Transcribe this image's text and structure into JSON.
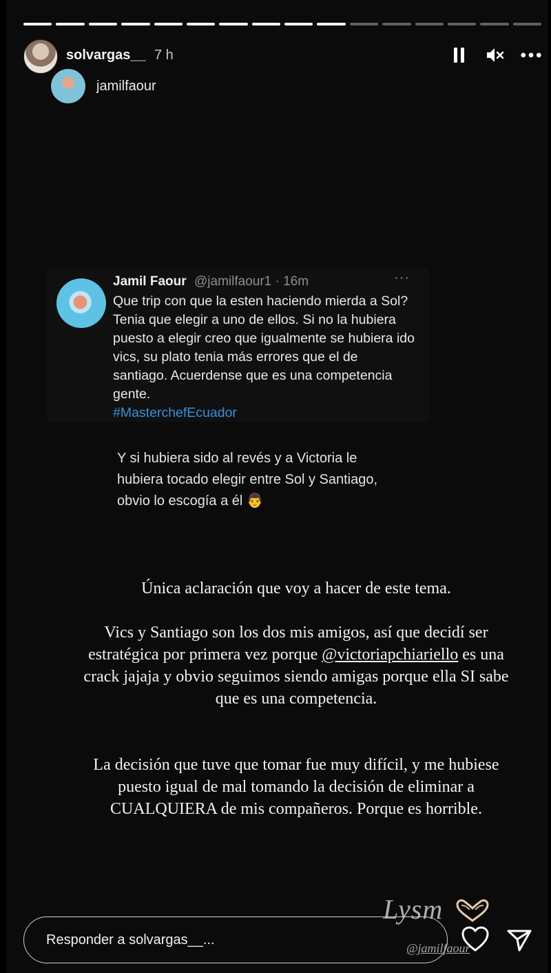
{
  "story": {
    "progress": {
      "segments": 16,
      "completed": 10
    },
    "header": {
      "username": "solvargas__",
      "time": "7 h",
      "mention": "jamilfaour"
    },
    "tweet": {
      "name": "Jamil Faour",
      "handle": "@jamilfaour1 · 16m",
      "more": "···",
      "text": "Que trip con que la esten haciendo mierda a Sol? Tenia que elegir a uno de ellos. Si no la hubiera puesto a elegir creo que igualmente se hubiera ido vics, su plato tenia más errores que el de santiago. Acuerdense que es una competencia gente.",
      "hashtag": "#MasterchefEcuador"
    },
    "comment": "Y si hubiera sido al revés y a Victoria le hubiera tocado elegir entre Sol y Santiago, obvio lo escogía a él 👨",
    "body": {
      "p1": "Única aclaración que voy a hacer de este tema.",
      "p2_before": "Vics y Santiago son los dos mis amigos, así que decidí ser estratégica por primera vez porque ",
      "p2_link": "@victoriapchiariello",
      "p2_after": " es una crack jajaja y obvio seguimos siendo amigas porque ella SI sabe que es una competencia.",
      "p3": "La decisión que tuve que tomar fue muy difícil, y me hubiese puesto igual de mal tomando la decisión de eliminar a CUALQUIERA de mis compañeros. Porque es horrible."
    },
    "stickers": {
      "lysm": "Lysm",
      "handle": "@jamilfaour"
    },
    "reply": {
      "placeholder": "Responder a solvargas__..."
    }
  }
}
